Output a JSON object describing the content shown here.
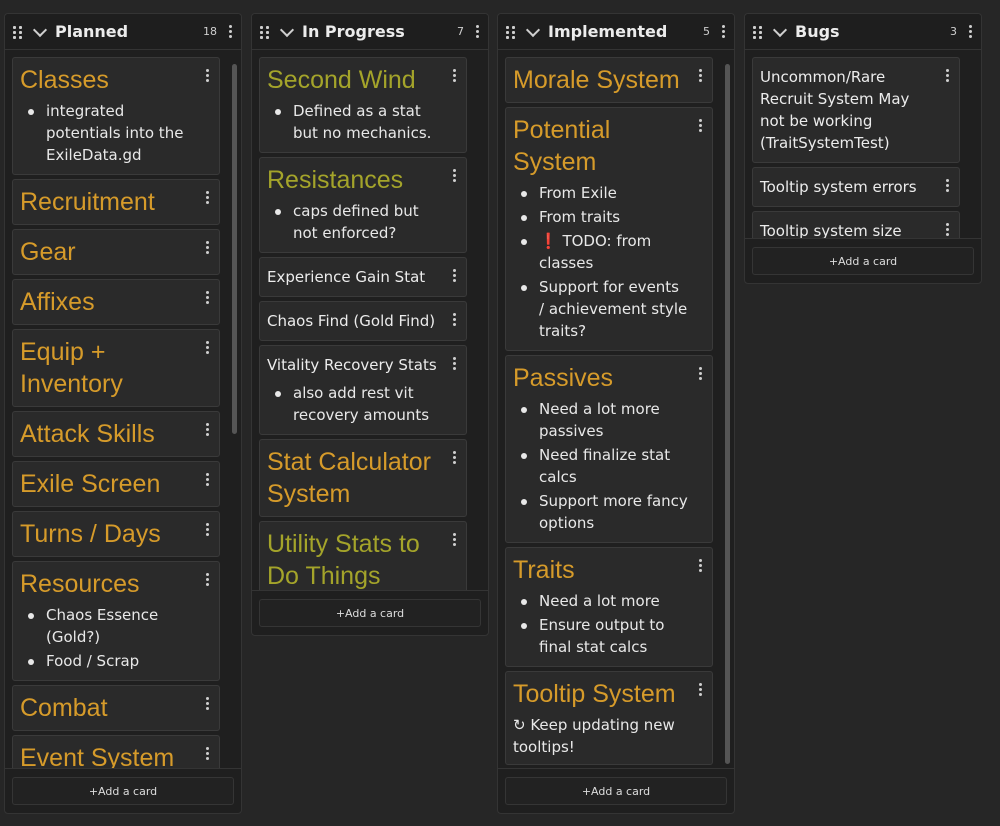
{
  "columns": [
    {
      "title": "Planned",
      "count": "18",
      "cards": [
        {
          "title": "Classes",
          "style": "heading",
          "bullets": [
            "integrated potentials into the ExileData.gd"
          ]
        },
        {
          "title": "Recruitment",
          "style": "heading"
        },
        {
          "title": "Gear",
          "style": "heading"
        },
        {
          "title": "Affixes",
          "style": "heading"
        },
        {
          "title": "Equip + Inventory",
          "style": "heading"
        },
        {
          "title": "Attack Skills",
          "style": "heading"
        },
        {
          "title": "Exile Screen",
          "style": "heading"
        },
        {
          "title": "Turns / Days",
          "style": "heading"
        },
        {
          "title": "Resources",
          "style": "heading",
          "bullets": [
            "Chaos Essence (Gold?)",
            "Food / Scrap"
          ]
        },
        {
          "title": "Combat",
          "style": "heading"
        },
        {
          "title": "Event System",
          "style": "heading"
        }
      ],
      "add_label": "+Add a card"
    },
    {
      "title": "In Progress",
      "count": "7",
      "cards": [
        {
          "title": "Second Wind",
          "style": "heading-green",
          "bullets": [
            "Defined as a stat but no mechanics."
          ]
        },
        {
          "title": "Resistances",
          "style": "heading-green",
          "bullets": [
            "caps defined but not enforced?"
          ]
        },
        {
          "title": "Experience Gain Stat",
          "style": "plain"
        },
        {
          "title": "Chaos Find (Gold Find)",
          "style": "plain"
        },
        {
          "title": "Vitality Recovery Stats",
          "style": "plain",
          "bullets": [
            "also add rest vit recovery amounts"
          ]
        },
        {
          "title": "Stat Calculator System",
          "style": "heading"
        },
        {
          "title": "Utility Stats to Do Things",
          "style": "heading-green"
        }
      ],
      "add_label": "+Add a card"
    },
    {
      "title": "Implemented",
      "count": "5",
      "cards": [
        {
          "title": "Morale System",
          "style": "heading"
        },
        {
          "title": "Potential System",
          "style": "heading",
          "bullets": [
            "From Exile",
            "From traits",
            "❗ TODO: from classes",
            "Support for events / achievement style traits?"
          ]
        },
        {
          "title": "Passives",
          "style": "heading",
          "bullets": [
            "Need a lot more passives",
            "Need finalize stat calcs",
            "Support more fancy options"
          ]
        },
        {
          "title": "Traits",
          "style": "heading",
          "bullets": [
            "Need a lot more",
            "Ensure output to final stat calcs"
          ]
        },
        {
          "title": "Tooltip System",
          "style": "heading",
          "note": "↻ Keep updating new tooltips!"
        }
      ],
      "add_label": "+Add a card"
    },
    {
      "title": "Bugs",
      "count": "3",
      "cards": [
        {
          "title": "Uncommon/Rare Recruit System May not be working (TraitSystemTest)",
          "style": "plain"
        },
        {
          "title": "Tooltip system errors",
          "style": "plain"
        },
        {
          "title": "Tooltip system size clamping",
          "style": "plain"
        }
      ],
      "add_label": "+Add a card"
    }
  ],
  "colors": {
    "background": "#262626",
    "column_bg": "#1f1f1f",
    "card_bg": "#2a2a2a",
    "heading_orange": "#d69b2a",
    "heading_green": "#a4a42a",
    "todo_red": "#e0303a"
  }
}
